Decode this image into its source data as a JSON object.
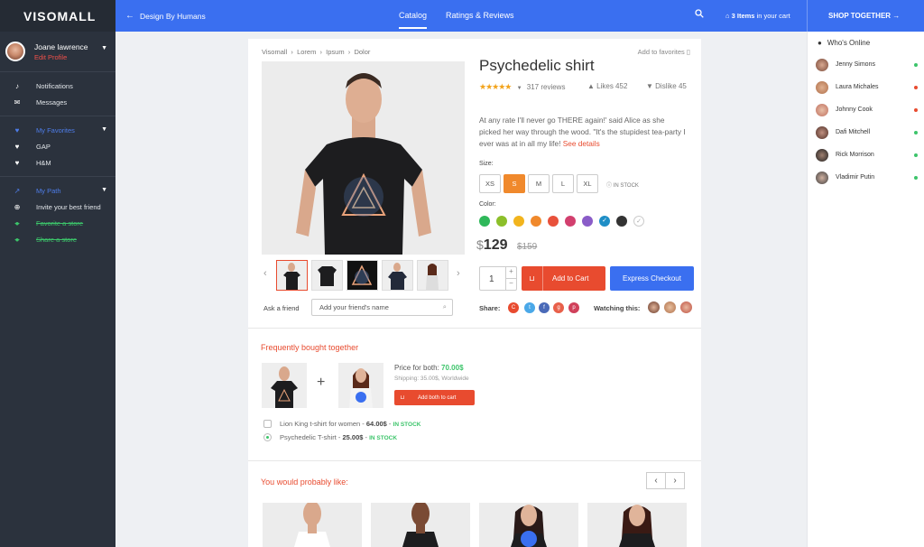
{
  "sidebar": {
    "logo": "VISOMALL",
    "user": {
      "name": "Joane lawrence",
      "edit": "Edit Profile"
    },
    "items": [
      {
        "label": "Notifications",
        "icon": "bell-icon"
      },
      {
        "label": "Messages",
        "icon": "envelope-icon"
      }
    ],
    "favorites": {
      "title": "My Favorites",
      "items": [
        "GAP",
        "H&M"
      ]
    },
    "path": {
      "title": "My Path",
      "items": [
        "Invite your best friend",
        "Favorite a store",
        "Share a store"
      ]
    }
  },
  "topbar": {
    "title": "Design By Humans",
    "tabs": [
      "Catalog",
      "Ratings & Reviews"
    ],
    "cart_count": "3 Items",
    "cart_suffix": "in your cart",
    "shop_together": "SHOP TOGETHER"
  },
  "online": {
    "title": "Who's Online",
    "users": [
      {
        "name": "Jenny Simons",
        "status_color": "#3cc46a"
      },
      {
        "name": "Laura Michales",
        "status_color": "#e84b2f"
      },
      {
        "name": "Johnny Cook",
        "status_color": "#e84b2f"
      },
      {
        "name": "Dafi Mitchell",
        "status_color": "#3cc46a"
      },
      {
        "name": "Rick Morrison",
        "status_color": "#3cc46a"
      },
      {
        "name": "Vladimir Putin",
        "status_color": "#3cc46a"
      }
    ]
  },
  "product": {
    "breadcrumb": [
      "Visomall",
      "Lorem",
      "Ipsum",
      "Dolor"
    ],
    "add_favorites": "Add to favorites",
    "title": "Psychedelic shirt",
    "reviews": "317 reviews",
    "likes": "Likes 452",
    "dislikes": "Dislike 45",
    "description": "At any rate I'll never go THERE again!' said Alice as she picked her way through the wood. \"It's the stupidest tea-party I ever was at in all my life!",
    "see_details": "See details",
    "size_label": "Size:",
    "sizes": [
      "XS",
      "S",
      "M",
      "L",
      "XL"
    ],
    "selected_size": "S",
    "in_stock": "IN STOCK",
    "color_label": "Color:",
    "colors": [
      "#2fb85a",
      "#8cbf2a",
      "#f2b41d",
      "#f0892c",
      "#e8513b",
      "#d23f6e",
      "#8a5cc8",
      "#1f8ec6",
      "#333333",
      "#ffffff"
    ],
    "price_symbol": "$",
    "price": "129",
    "old_price": "$159",
    "quantity": "1",
    "add_to_cart": "Add to Cart",
    "express_checkout": "Express Checkout",
    "ask_friend": "Ask a friend",
    "friend_placeholder": "Add your friend's name",
    "share_label": "Share:",
    "watching_label": "Watching this:"
  },
  "bought_together": {
    "title": "Frequently bought together",
    "price_label": "Price for both:",
    "price": "70.00$",
    "shipping": "Shipping: 35.00$, Worldwide",
    "add_both": "Add both to cart",
    "items": [
      {
        "name": "Lion King t-shirt for women",
        "price": "64.00$",
        "stock": "IN STOCK",
        "checked": false
      },
      {
        "name": "Psychedelic T-shirt",
        "price": "25.00$",
        "stock": "IN STOCK",
        "checked": true
      }
    ]
  },
  "recommendations": {
    "title": "You would probably like:"
  }
}
